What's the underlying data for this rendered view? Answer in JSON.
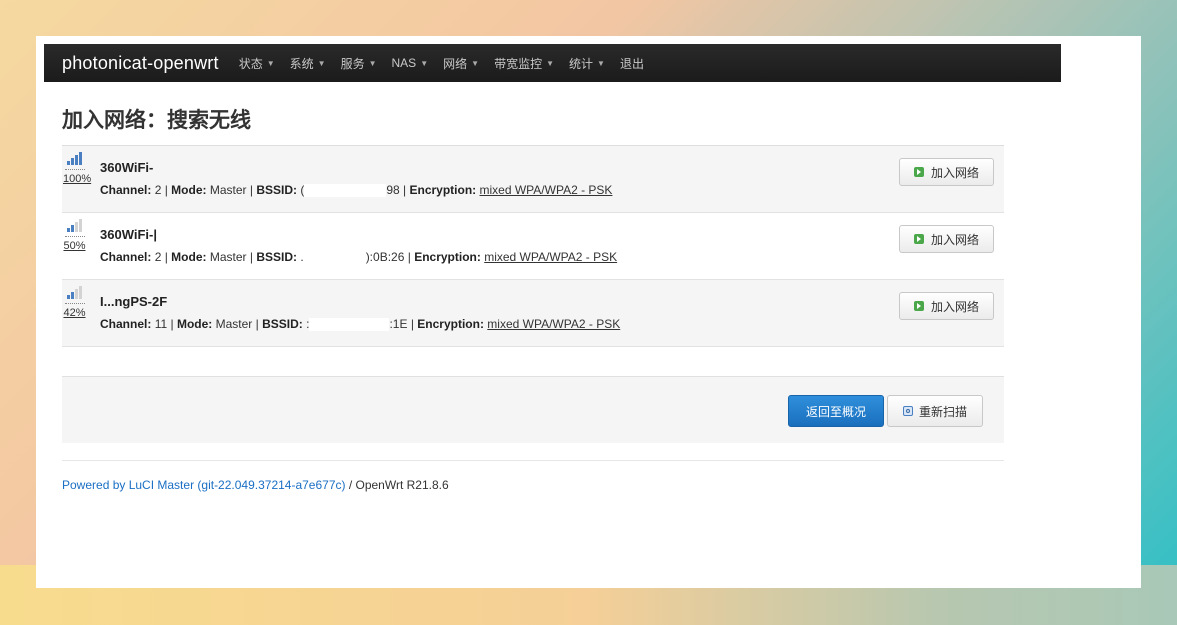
{
  "navbar": {
    "brand": "photonicat-openwrt",
    "menu": [
      {
        "label": "状态",
        "has_caret": true
      },
      {
        "label": "系统",
        "has_caret": true
      },
      {
        "label": "服务",
        "has_caret": true
      },
      {
        "label": "NAS",
        "has_caret": true
      },
      {
        "label": "网络",
        "has_caret": true
      },
      {
        "label": "带宽监控",
        "has_caret": true
      },
      {
        "label": "统计",
        "has_caret": true
      },
      {
        "label": "退出",
        "has_caret": false
      }
    ]
  },
  "page": {
    "title": "加入网络：搜索无线"
  },
  "labels": {
    "channel": "Channel:",
    "mode": "Mode:",
    "bssid": "BSSID:",
    "encryption": "Encryption:",
    "join_button": "加入网络"
  },
  "networks": [
    {
      "ssid": "360WiFi-",
      "signal": "100%",
      "signal_level": 1.0,
      "channel": "2",
      "mode": "Master",
      "bssid_prefix": "(",
      "bssid_suffix": "98",
      "encryption": "mixed WPA/WPA2 - PSK"
    },
    {
      "ssid": "360WiFi-|",
      "signal": "50%",
      "signal_level": 0.5,
      "channel": "2",
      "mode": "Master",
      "bssid_prefix": ".",
      "bssid_suffix": "):0B:26",
      "encryption": "mixed WPA/WPA2 - PSK"
    },
    {
      "ssid": "I...ngPS-2F",
      "signal": "42%",
      "signal_level": 0.42,
      "channel": "11",
      "mode": "Master",
      "bssid_prefix": ":",
      "bssid_suffix": ":1E",
      "encryption": "mixed WPA/WPA2 - PSK"
    }
  ],
  "actions": {
    "back_label": "返回至概况",
    "rescan_label": "重新扫描"
  },
  "footer": {
    "link_text": "Powered by LuCI Master (git-22.049.37214-a7e677c)",
    "suffix": " / OpenWrt R21.8.6"
  },
  "colors": {
    "navbar_bg": "#1b1b1b",
    "primary_button": "#1a6fbd",
    "link": "#1a6fc4",
    "signal_on": "#4a7fc1",
    "join_icon": "#4aa84a"
  },
  "icons": [
    "signal-strength-icon",
    "join-icon",
    "rescan-icon",
    "caret-down-icon"
  ]
}
